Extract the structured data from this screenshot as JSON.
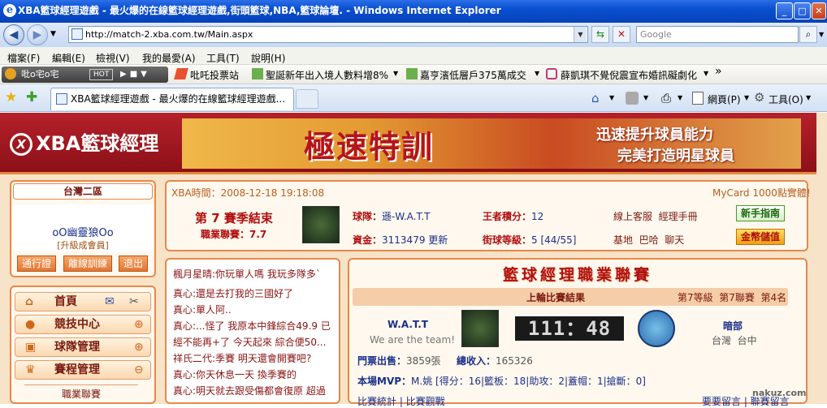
{
  "window": {
    "title": "XBA籃球經理遊戲 - 最火爆的在線籃球經理遊戲,街頭籃球,NBA,籃球論壇. - Windows Internet Explorer",
    "minimize": "_",
    "maximize": "□",
    "close": "✕"
  },
  "address": {
    "url": "http://match-2.xba.com.tw/Main.aspx",
    "search_placeholder": "Google"
  },
  "menu": [
    "檔案(F)",
    "編輯(E)",
    "檢視(V)",
    "我的最愛(A)",
    "工具(T)",
    "說明(H)"
  ],
  "links_toolbar": {
    "radio_label": "吡o宅o宅",
    "radio_hot": "HOT",
    "items": [
      "吡吒投票站",
      "聖誕新年出入境人數料增8%",
      "嘉亨濱低層戶375萬成交",
      "薛凱琪不覺倪震宣布婚訊礙劇化"
    ],
    "more": "»"
  },
  "tab": {
    "label": "XBA籃球經理遊戲 - 最火爆的在線籃球經理遊戲...",
    "page_menu": "網頁(P)",
    "tools_menu": "工具(O)"
  },
  "banner": {
    "logo": "XBA籃球經理",
    "ad_big": "極速特訓",
    "ad_line1": "迅速提升球員能力",
    "ad_line2": "完美打造明星球員"
  },
  "left": {
    "region": "台灣二區",
    "username": "oO幽靈狼Oo",
    "member_upgrade": "[升級成會員]",
    "btn_pass": "通行證",
    "btn_offline": "離線訓練",
    "btn_exit": "退出",
    "nav_home": "首頁",
    "nav_arena": "競技中心",
    "nav_team": "球隊管理",
    "nav_schedule": "賽程管理",
    "nav_sub_league": "職業聯賽"
  },
  "info": {
    "time_label": "XBA時間：2008-12-18 19:18:08",
    "mycard": "MyCard 1000點實體!",
    "season": "第 7 賽季結束",
    "league_rating": "職業聯賽：7.7",
    "team_label": "球隊：",
    "team_value": "遜-W.A.T.T",
    "points_label": "王者積分：",
    "points_value": "12",
    "funds_label": "資金：",
    "funds_value": "3113479",
    "update": "更新",
    "street_label": "街球等級：",
    "street_value": "5 [44/55]",
    "links_row1": "線上客服  經理手冊",
    "links_row2": "基地  巴哈  聊天",
    "btn_guide": "新手指南",
    "btn_gold": "金幣儲值"
  },
  "chat": [
    "楓月星晴:你玩單人嗎 我玩多隊多`",
    "真心:還是去打我的三國好了",
    "真心:單人阿..",
    "真心:...怪了 我原本中鋒綜合49.9 已經不能再+了 今天起來 綜合便50...",
    "祥氏二代:季賽 明天還會開賽吧?",
    "真心:你天休息一天 換季賽的",
    "真心:明天就去跟受傷都會復原 超過"
  ],
  "league": {
    "title": "籃球經理職業聯賽",
    "last_result": "上輪比賽結果",
    "level": "第7等級  第7聯賽  第4名",
    "home_team": "W.A.T.T",
    "slogan": "We are the team!",
    "score": "111：48",
    "away_team": "暗部",
    "away_loc": "台灣  台中",
    "tickets_label": "門票出售：",
    "tickets_value": "3859張",
    "income_label": "總收入：",
    "income_value": "165326",
    "mvp_label": "本場MVP：",
    "mvp_value": "M.姚  [得分：16|籃板：18|助攻：2|蓋帽：1|搶斷：0]",
    "link_stats": "比賽統計 | 比賽觀戰",
    "link_msg": "要要留言 | 聯賽留言"
  },
  "watermark": "nakuz.com"
}
